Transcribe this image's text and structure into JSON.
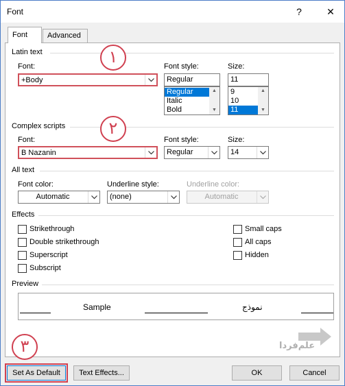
{
  "window": {
    "title": "Font",
    "help": "?",
    "close": "✕"
  },
  "tabs": [
    {
      "label": "Font"
    },
    {
      "label": "Advanced"
    }
  ],
  "latin": {
    "group": "Latin text",
    "font_label": "Font:",
    "font_value": "+Body",
    "style_label": "Font style:",
    "style_value": "Regular",
    "style_options": [
      "Regular",
      "Italic",
      "Bold"
    ],
    "style_selected_index": 0,
    "size_label": "Size:",
    "size_value": "11",
    "size_options": [
      "9",
      "10",
      "11"
    ],
    "size_selected_index": 2
  },
  "complex": {
    "group": "Complex scripts",
    "font_label": "Font:",
    "font_value": "B Nazanin",
    "style_label": "Font style:",
    "style_value": "Regular",
    "size_label": "Size:",
    "size_value": "14"
  },
  "alltext": {
    "group": "All text",
    "color_label": "Font color:",
    "color_value": "Automatic",
    "underline_label": "Underline style:",
    "underline_value": "(none)",
    "underline_color_label": "Underline color:",
    "underline_color_value": "Automatic"
  },
  "effects": {
    "group": "Effects",
    "left": [
      {
        "label": "Strikethrough",
        "checked": false
      },
      {
        "label": "Double strikethrough",
        "checked": false
      },
      {
        "label": "Superscript",
        "checked": false
      },
      {
        "label": "Subscript",
        "checked": false
      }
    ],
    "right": [
      {
        "label": "Small caps",
        "checked": false
      },
      {
        "label": "All caps",
        "checked": false
      },
      {
        "label": "Hidden",
        "checked": false
      }
    ]
  },
  "preview": {
    "group": "Preview",
    "sample_latin": "Sample",
    "sample_complex": "نموذج"
  },
  "annotations": {
    "one": "١",
    "two": "٢",
    "three": "٣"
  },
  "watermark": {
    "text": "علم‌فردا"
  },
  "buttons": {
    "set_default": "Set As Default",
    "text_effects": "Text Effects...",
    "ok": "OK",
    "cancel": "Cancel"
  },
  "colors": {
    "accent": "#0078d7",
    "annotation": "#d04050",
    "window_border": "#4a7cc7"
  }
}
